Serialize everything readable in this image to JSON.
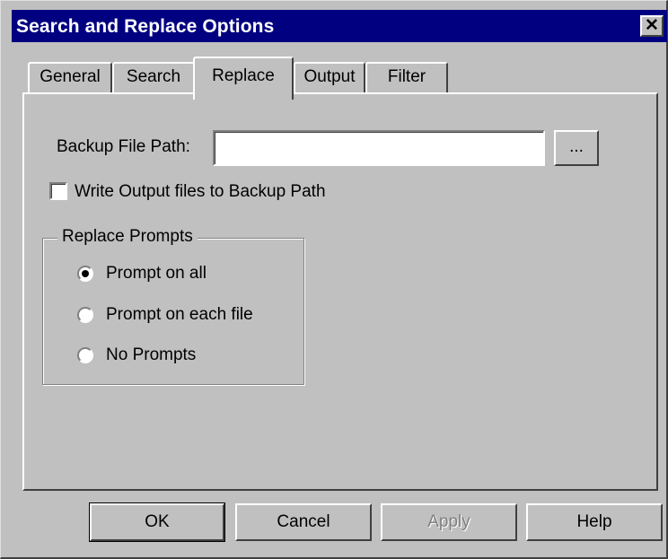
{
  "window": {
    "title": "Search and Replace Options",
    "close_glyph": "✕"
  },
  "tabs": [
    {
      "label": "General",
      "active": false
    },
    {
      "label": "Search",
      "active": false
    },
    {
      "label": "Replace",
      "active": true
    },
    {
      "label": "Output",
      "active": false
    },
    {
      "label": "Filter",
      "active": false
    }
  ],
  "replace_tab": {
    "backup_path_label": "Backup File Path:",
    "backup_path_value": "",
    "browse_label": "...",
    "write_output_label": "Write Output files to Backup Path",
    "write_output_checked": false,
    "prompts_group_label": "Replace Prompts",
    "prompts": [
      {
        "label": "Prompt on all",
        "selected": true
      },
      {
        "label": "Prompt on each file",
        "selected": false
      },
      {
        "label": "No Prompts",
        "selected": false
      }
    ]
  },
  "buttons": {
    "ok": "OK",
    "cancel": "Cancel",
    "apply": "Apply",
    "apply_enabled": false,
    "help": "Help"
  }
}
